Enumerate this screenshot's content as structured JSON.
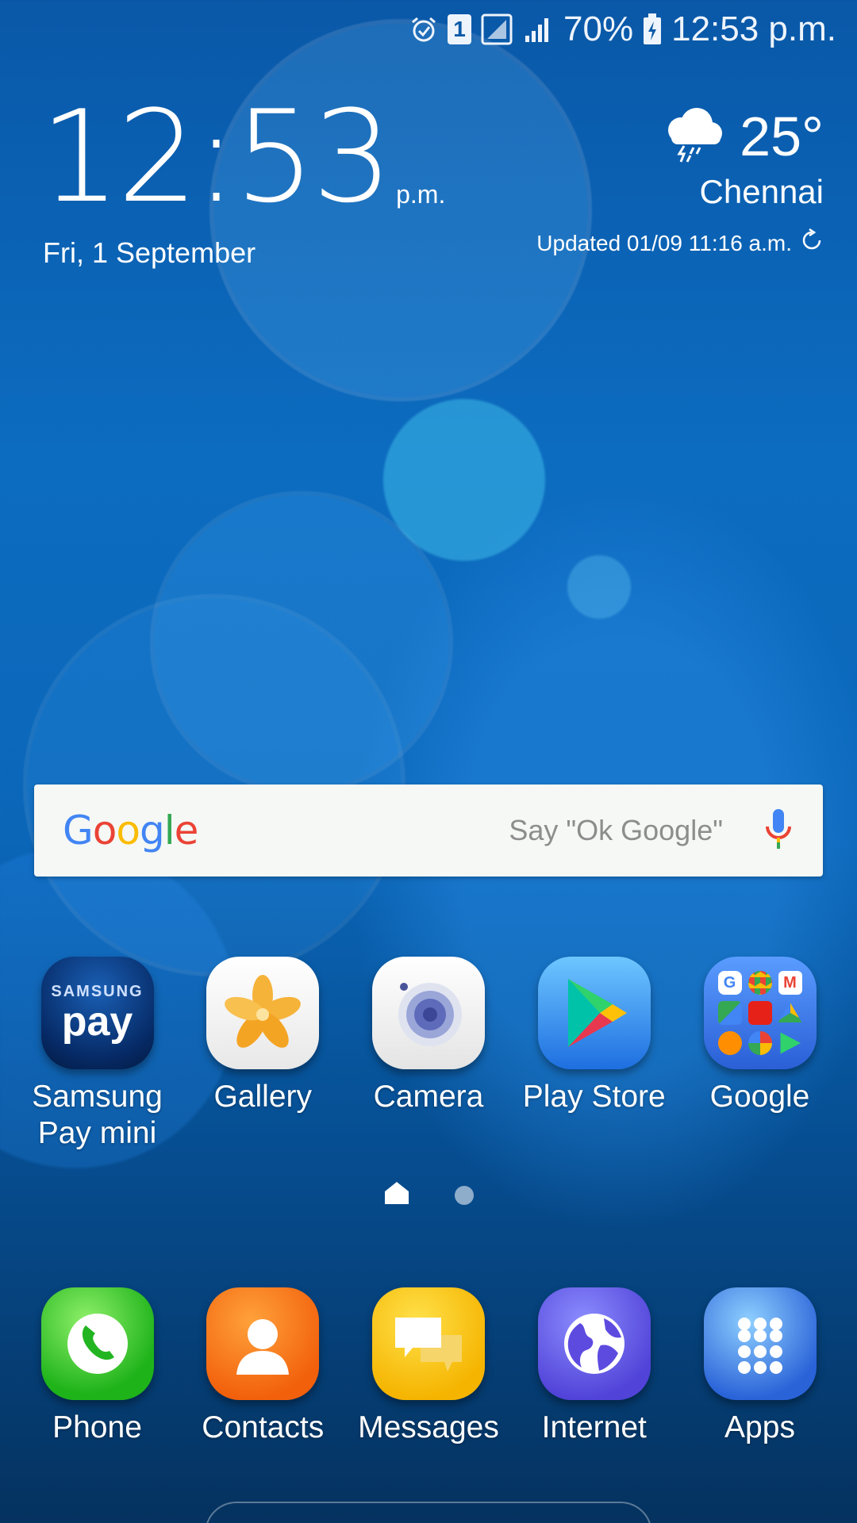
{
  "status_bar": {
    "battery": "70%",
    "time": "12:53 p.m.",
    "sim_slot": "1"
  },
  "clock": {
    "time": "12:53",
    "ampm": "p.m.",
    "date": "Fri, 1 September"
  },
  "weather": {
    "temperature": "25°",
    "city": "Chennai",
    "updated": "Updated 01/09 11:16 a.m.",
    "icon": "thunder-cloud-icon"
  },
  "search": {
    "logo": "Google",
    "hint": "Say \"Ok Google\""
  },
  "apps": [
    {
      "label": "Samsung Pay mini",
      "icon": "samsung-pay-icon"
    },
    {
      "label": "Gallery",
      "icon": "gallery-icon"
    },
    {
      "label": "Camera",
      "icon": "camera-icon"
    },
    {
      "label": "Play Store",
      "icon": "play-store-icon"
    },
    {
      "label": "Google",
      "icon": "google-folder-icon"
    }
  ],
  "dock": [
    {
      "label": "Phone",
      "icon": "phone-icon"
    },
    {
      "label": "Contacts",
      "icon": "contacts-icon"
    },
    {
      "label": "Messages",
      "icon": "messages-icon"
    },
    {
      "label": "Internet",
      "icon": "internet-icon"
    },
    {
      "label": "Apps",
      "icon": "apps-grid-icon"
    }
  ],
  "samsung_pay_logo": {
    "top": "SAMSUNG",
    "bottom": "pay"
  }
}
